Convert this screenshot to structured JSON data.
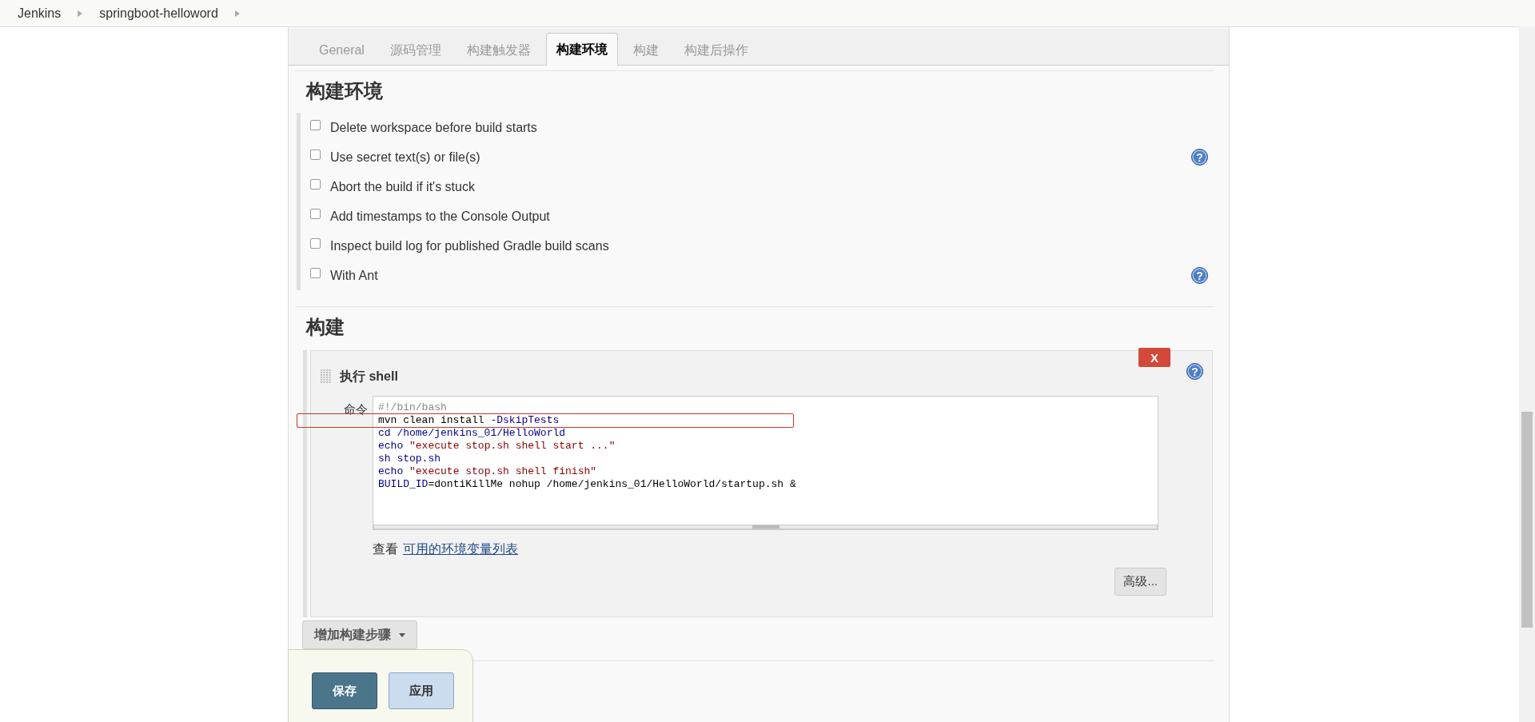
{
  "breadcrumbs": [
    "Jenkins",
    "springboot-helloword"
  ],
  "tabs": [
    {
      "label": "General",
      "selected": false
    },
    {
      "label": "源码管理",
      "selected": false
    },
    {
      "label": "构建触发器",
      "selected": false
    },
    {
      "label": "构建环境",
      "selected": true
    },
    {
      "label": "构建",
      "selected": false
    },
    {
      "label": "构建后操作",
      "selected": false
    }
  ],
  "build_environment": {
    "title": "构建环境",
    "options": [
      {
        "label": "Delete workspace before build starts",
        "checked": false
      },
      {
        "label": "Use secret text(s) or file(s)",
        "checked": false,
        "help": "?"
      },
      {
        "label": "Abort the build if it's stuck",
        "checked": false
      },
      {
        "label": "Add timestamps to the Console Output",
        "checked": false
      },
      {
        "label": "Inspect build log for published Gradle build scans",
        "checked": false
      },
      {
        "label": "With Ant",
        "checked": false,
        "help": "?"
      }
    ]
  },
  "build": {
    "title": "构建",
    "step": {
      "title": "执行 shell",
      "delete_button": "X",
      "command_label": "命令",
      "help": "?",
      "code": [
        {
          "highlighted": false,
          "segments": [
            {
              "kind": "comment",
              "text": "#!/bin/bash"
            }
          ]
        },
        {
          "highlighted": true,
          "segments": [
            {
              "kind": "plain",
              "text": "mvn clean install "
            },
            {
              "kind": "keyword",
              "text": "-DskipTests"
            }
          ]
        },
        {
          "highlighted": false,
          "segments": [
            {
              "kind": "keyword",
              "text": "cd /home/jenkins_01/HelloWorld"
            }
          ]
        },
        {
          "highlighted": false,
          "segments": [
            {
              "kind": "keyword",
              "text": "echo"
            },
            {
              "kind": "string",
              "text": " \"execute stop.sh shell start ...\""
            }
          ]
        },
        {
          "highlighted": false,
          "segments": [
            {
              "kind": "keyword",
              "text": "sh stop.sh"
            }
          ]
        },
        {
          "highlighted": false,
          "segments": [
            {
              "kind": "keyword",
              "text": "echo"
            },
            {
              "kind": "string",
              "text": " \"execute stop.sh shell finish\""
            }
          ]
        },
        {
          "highlighted": false,
          "segments": [
            {
              "kind": "keyword",
              "text": "BUILD_ID"
            },
            {
              "kind": "plain",
              "text": "=dontiKillMe nohup /home/jenkins_01/HelloWorld/startup.sh &"
            }
          ]
        }
      ],
      "env_prefix": "查看",
      "env_link": "可用的环境变量列表",
      "advanced_button": "高级..."
    },
    "add_step_button": "增加构建步骤"
  },
  "save_bar": {
    "save": "保存",
    "apply": "应用"
  }
}
